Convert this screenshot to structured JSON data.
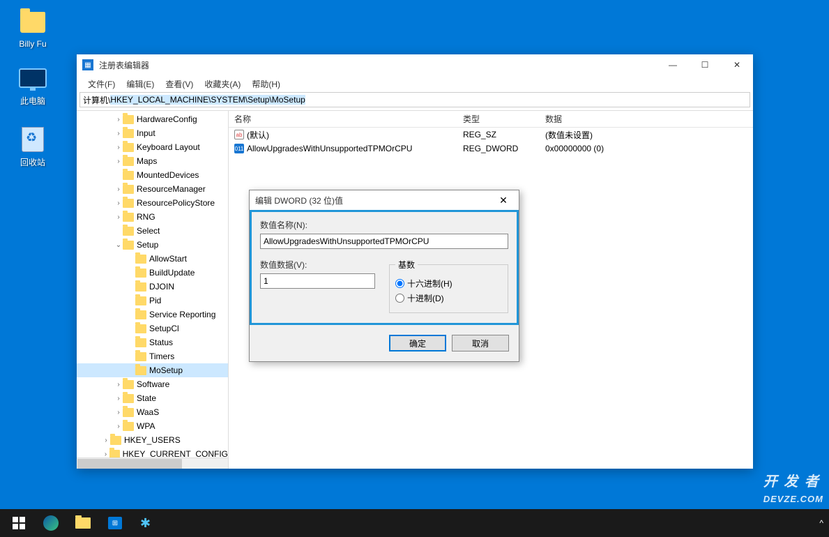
{
  "desktop": {
    "icons": [
      {
        "label": "Billy Fu",
        "kind": "folder"
      },
      {
        "label": "此电脑",
        "kind": "pc"
      },
      {
        "label": "回收站",
        "kind": "recycle"
      }
    ]
  },
  "window": {
    "title": "注册表编辑器",
    "menu": [
      "文件(F)",
      "编辑(E)",
      "查看(V)",
      "收藏夹(A)",
      "帮助(H)"
    ],
    "path_prefix": "计算机\\",
    "path_highlight": "HKEY_LOCAL_MACHINE\\SYSTEM\\Setup\\MoSetup",
    "win_controls": {
      "min": "—",
      "max": "☐",
      "close": "✕"
    },
    "tree": [
      {
        "indent": 3,
        "chev": ">",
        "label": "HardwareConfig"
      },
      {
        "indent": 3,
        "chev": ">",
        "label": "Input"
      },
      {
        "indent": 3,
        "chev": ">",
        "label": "Keyboard Layout"
      },
      {
        "indent": 3,
        "chev": ">",
        "label": "Maps"
      },
      {
        "indent": 3,
        "chev": "",
        "label": "MountedDevices"
      },
      {
        "indent": 3,
        "chev": ">",
        "label": "ResourceManager"
      },
      {
        "indent": 3,
        "chev": ">",
        "label": "ResourcePolicyStore"
      },
      {
        "indent": 3,
        "chev": ">",
        "label": "RNG"
      },
      {
        "indent": 3,
        "chev": "",
        "label": "Select"
      },
      {
        "indent": 3,
        "chev": "v",
        "label": "Setup"
      },
      {
        "indent": 4,
        "chev": "",
        "label": "AllowStart"
      },
      {
        "indent": 4,
        "chev": "",
        "label": "BuildUpdate"
      },
      {
        "indent": 4,
        "chev": "",
        "label": "DJOIN"
      },
      {
        "indent": 4,
        "chev": "",
        "label": "Pid"
      },
      {
        "indent": 4,
        "chev": "",
        "label": "Service Reporting"
      },
      {
        "indent": 4,
        "chev": "",
        "label": "SetupCl"
      },
      {
        "indent": 4,
        "chev": "",
        "label": "Status"
      },
      {
        "indent": 4,
        "chev": "",
        "label": "Timers"
      },
      {
        "indent": 4,
        "chev": "",
        "label": "MoSetup",
        "selected": true
      },
      {
        "indent": 3,
        "chev": ">",
        "label": "Software"
      },
      {
        "indent": 3,
        "chev": ">",
        "label": "State"
      },
      {
        "indent": 3,
        "chev": ">",
        "label": "WaaS"
      },
      {
        "indent": 3,
        "chev": ">",
        "label": "WPA"
      },
      {
        "indent": 2,
        "chev": ">",
        "label": "HKEY_USERS"
      },
      {
        "indent": 2,
        "chev": ">",
        "label": "HKEY_CURRENT_CONFIG"
      }
    ],
    "list": {
      "headers": {
        "name": "名称",
        "type": "类型",
        "data": "数据"
      },
      "rows": [
        {
          "icon": "sz",
          "ilabel": "ab",
          "name": "(默认)",
          "type": "REG_SZ",
          "data": "(数值未设置)"
        },
        {
          "icon": "dw",
          "ilabel": "011",
          "name": "AllowUpgradesWithUnsupportedTPMOrCPU",
          "type": "REG_DWORD",
          "data": "0x00000000 (0)"
        }
      ]
    }
  },
  "dialog": {
    "title": "编辑 DWORD (32 位)值",
    "name_label": "数值名称(N):",
    "name_value": "AllowUpgradesWithUnsupportedTPMOrCPU",
    "data_label": "数值数据(V):",
    "data_value": "1",
    "base_label": "基数",
    "radio_hex": "十六进制(H)",
    "radio_dec": "十进制(D)",
    "radio_selected": "hex",
    "ok": "确定",
    "cancel": "取消"
  },
  "taskbar": {
    "items": [
      "start",
      "edge",
      "explorer",
      "store",
      "app"
    ]
  },
  "watermark": "开发者\nDEVZE.COM",
  "tray": {
    "chevron": "^"
  }
}
